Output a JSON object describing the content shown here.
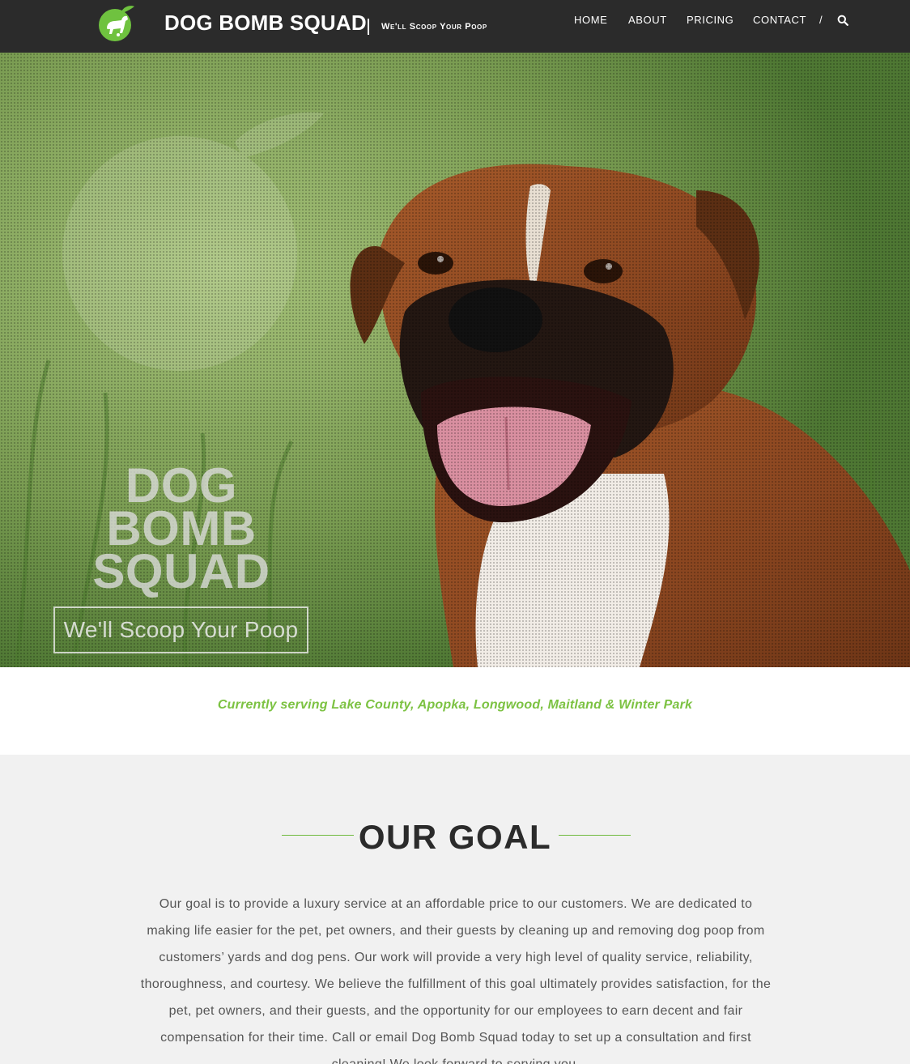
{
  "header": {
    "brand_name": "DOG BOMB SQUAD",
    "tagline": "We'll Scoop Your Poop",
    "nav": {
      "home": "HOME",
      "about": "ABOUT",
      "pricing": "PRICING",
      "contact": "CONTACT",
      "separator": "/"
    },
    "search_icon": "search-icon",
    "logo_icon": "dog-apple-logo"
  },
  "hero": {
    "title_line1": "DOG",
    "title_line2": "BOMB",
    "title_line3": "SQUAD",
    "button_label": "We'll Scoop Your Poop"
  },
  "service_area": {
    "text": "Currently serving Lake County, Apopka, Longwood, Maitland & Winter Park"
  },
  "goal": {
    "title": "OUR GOAL",
    "body": "Our goal is to provide a luxury service at an affordable price to our customers. We are dedicated to making life easier for the pet, pet owners, and their guests by cleaning up and removing dog poop from customers’ yards and dog pens. Our work will provide a very high level of quality service, reliability, thoroughness, and courtesy. We believe the fulfillment of this goal ultimately provides satisfaction, for the pet, pet owners, and their guests, and the opportunity for our employees to earn decent and fair compensation for their time. Call or email Dog Bomb Squad today to set up a consultation and first cleaning! We look forward to serving you."
  },
  "colors": {
    "accent_green": "#7cc242",
    "header_bg": "#2b2b2b",
    "section_bg": "#f1f1f1"
  }
}
